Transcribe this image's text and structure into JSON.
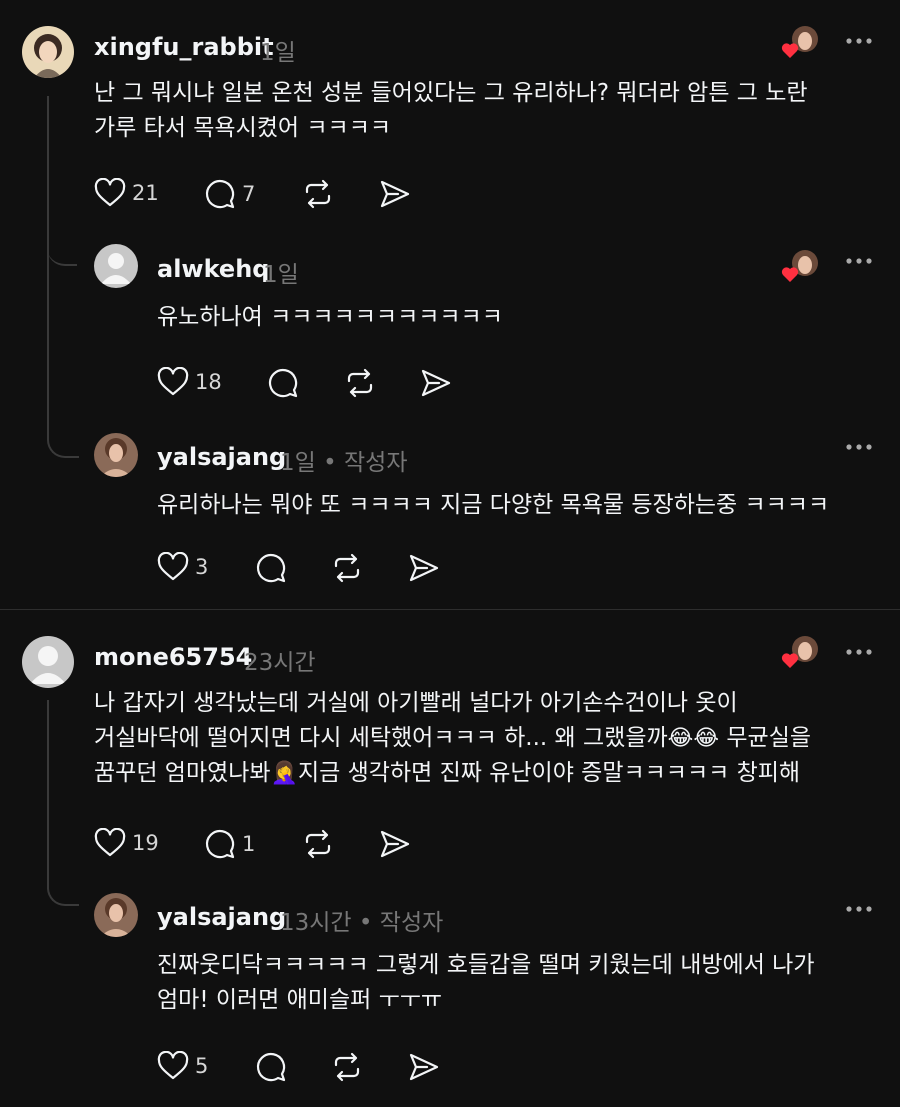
{
  "comments": [
    {
      "username": "xingfu_rabbit",
      "time": "1일",
      "lines": [
        "난 그 뭐시냐 일본 온천 성분 들어있다는 그 유리하나? 뭐더라 암튼 그 노란",
        "가루 타서 목욕시켰어 ㅋㅋㅋㅋ"
      ],
      "likes": "21",
      "replies": "7",
      "replies_list": [
        {
          "username": "alwkehq",
          "time": "1일",
          "lines": [
            "유노하나여 ㅋㅋㅋㅋㅋㅋㅋㅋㅋㅋㅋ"
          ],
          "likes": "18"
        },
        {
          "username": "yalsajang",
          "time": "1일",
          "author_tag": "작성자",
          "lines": [
            "유리하나는 뭐야 또 ㅋㅋㅋㅋ 지금 다양한 목욕물 등장하는중 ㅋㅋㅋㅋ"
          ],
          "likes": "3"
        }
      ]
    },
    {
      "username": "mone65754",
      "time": "23시간",
      "lines": [
        "나 갑자기 생각났는데 거실에 아기빨래 널다가 아기손수건이나 옷이",
        "거실바닥에 떨어지면 다시 세탁했어ㅋㅋㅋ 하... 왜 그랬을까",
        "꿈꾸던 엄마였나봐",
        "지금 생각하면 진짜 유난이야 증말ㅋㅋㅋㅋㅋ 창피해"
      ],
      "emoji_1": "😂😂",
      "line2_suffix": " 무균실을",
      "emoji_2": "🤦‍♀️",
      "likes": "19",
      "replies": "1",
      "replies_list": [
        {
          "username": "yalsajang",
          "time": "13시간",
          "author_tag": "작성자",
          "lines": [
            "진짜웃디닥ㅋㅋㅋㅋㅋ 그렇게 호들갑을 떨며 키웠는데 내방에서 나가",
            "엄마! 이러면 애미슬퍼 ㅜㅜㅠ"
          ],
          "likes": "5"
        }
      ]
    }
  ],
  "colors": {
    "background": "#101010",
    "text": "#f3f5f7",
    "muted": "#777777",
    "line": "#3a3a3a",
    "heart": "#ff3040"
  },
  "icons": [
    "heart-icon",
    "comment-icon",
    "repost-icon",
    "share-icon",
    "more-icon",
    "liked-by-author-icon"
  ]
}
